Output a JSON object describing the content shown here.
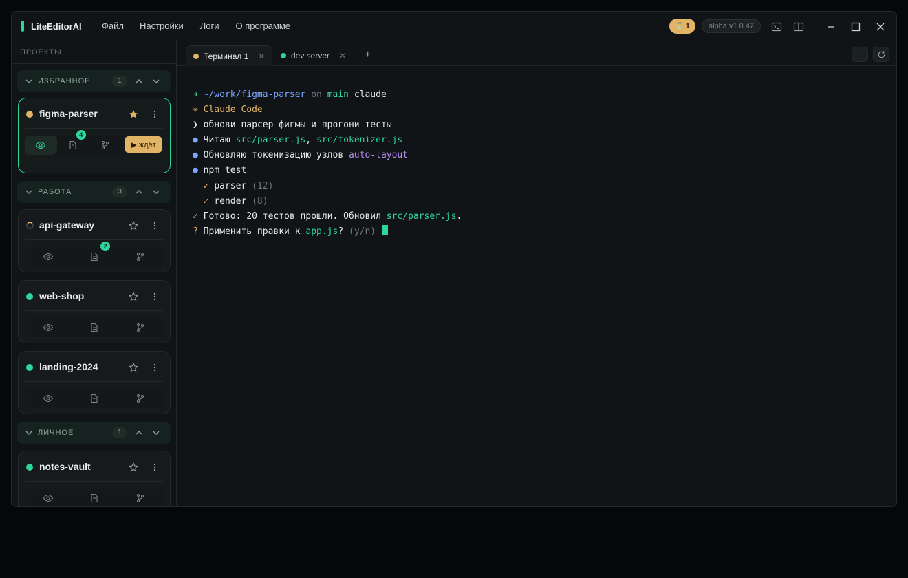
{
  "app": {
    "title": "LiteEditorAI",
    "menu": [
      "Файл",
      "Настройки",
      "Логи",
      "О программе"
    ],
    "task_count": "1",
    "version": "alpha v1.0.47"
  },
  "sidebar": {
    "heading": "ПРОЕКТЫ",
    "groups": [
      {
        "name": "ИЗБРАННОЕ",
        "count": "1"
      },
      {
        "name": "РАБОТА",
        "count": "3"
      },
      {
        "name": "ЛИЧНОЕ",
        "count": "1"
      }
    ],
    "projects": [
      {
        "name": "figma-parser",
        "status": "waiting",
        "starred": true,
        "changes": "4",
        "wait_label": "▶ ждёт"
      },
      {
        "name": "api-gateway",
        "status": "loading",
        "starred": false,
        "changes": "2"
      },
      {
        "name": "web-shop",
        "status": "ok",
        "starred": false
      },
      {
        "name": "landing-2024",
        "status": "ok",
        "starred": false
      },
      {
        "name": "notes-vault",
        "status": "ok",
        "starred": false
      }
    ]
  },
  "tabs": [
    {
      "label": "Терминал 1",
      "color": "#e2b466",
      "active": true
    },
    {
      "label": "dev server",
      "color": "#2fd69a",
      "active": false
    }
  ],
  "terminal": {
    "prompt": {
      "arrow": "➜",
      "path": "~/work/figma-parser",
      "on": "on",
      "branch": "main",
      "cmd": "claude"
    },
    "banner": "✳ Claude Code",
    "user_msg": "❯ обнови парсер фигмы и прогони тесты",
    "read": {
      "prefix": "Читаю",
      "file1": "src/parser.js",
      "sep": ",",
      "file2": "src/tokenizer.js"
    },
    "update": {
      "prefix": "Обновляю токенизацию узлов",
      "term": "auto-layout"
    },
    "run": "npm test",
    "tests": [
      {
        "name": "parser",
        "count": "(12)"
      },
      {
        "name": "render",
        "count": "(8)"
      }
    ],
    "done": {
      "prefix": "Готово: 20 тестов прошли. Обновил",
      "file": "src/parser.js",
      "suffix": "."
    },
    "question": {
      "prefix": "Применить правки к",
      "file": "app.js",
      "q": "?",
      "opts": "(y/n)"
    }
  },
  "colors": {
    "accent": "#2fd69a",
    "warning": "#e2b466",
    "info": "#7aa6ff",
    "purple": "#b58cf0"
  }
}
